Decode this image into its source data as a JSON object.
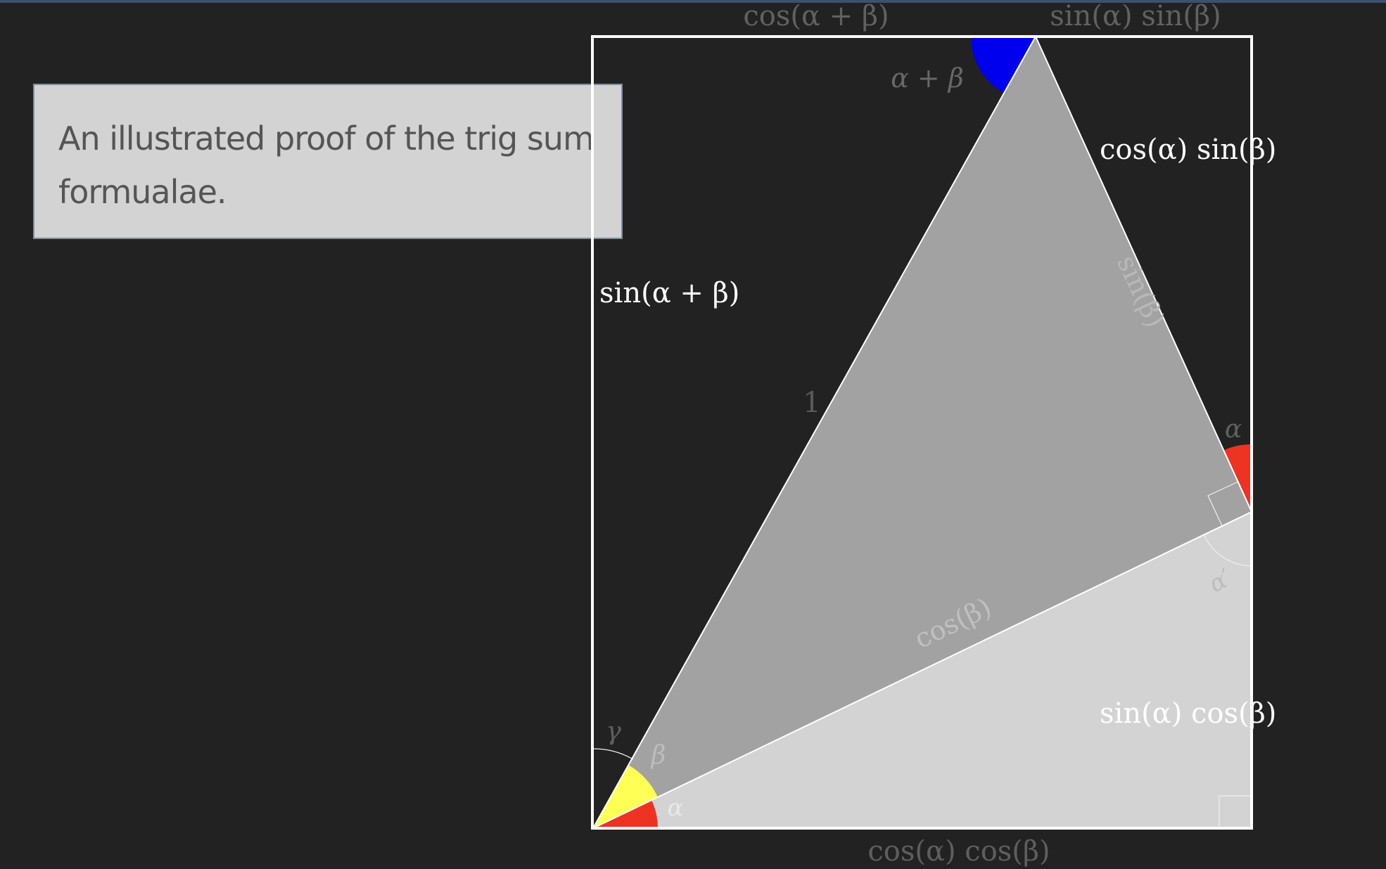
{
  "caption": "An illustrated proof of the trig sum formualae.",
  "labels": {
    "cos_alpha_plus_beta": "cos(α + β)",
    "sin_alpha_sin_beta": "sin(α) sin(β)",
    "angle_alpha_plus_beta": "α + β",
    "cos_alpha_sin_beta": "cos(α) sin(β)",
    "sin_alpha_plus_beta": "sin(α + β)",
    "sin_beta": "sin(β)",
    "hypotenuse_one": "1",
    "angle_alpha_right": "α",
    "angle_alpha_prime": "α′",
    "cos_beta": "cos(β)",
    "sin_alpha_cos_beta": "sin(α) cos(β)",
    "angle_gamma": "γ",
    "angle_beta": "β",
    "angle_alpha_bottom": "α",
    "cos_alpha_cos_beta": "cos(α) cos(β)"
  },
  "colors": {
    "background": "#222222",
    "caption_box": "#d3d3d3",
    "dark_triangle": "#a2a2a2",
    "light_triangle": "#d3d3d3",
    "alpha_wedge": "#ee3322",
    "beta_wedge": "#ffff55",
    "alpha_plus_beta_wedge": "#0000ee",
    "frame": "#ffffff"
  }
}
